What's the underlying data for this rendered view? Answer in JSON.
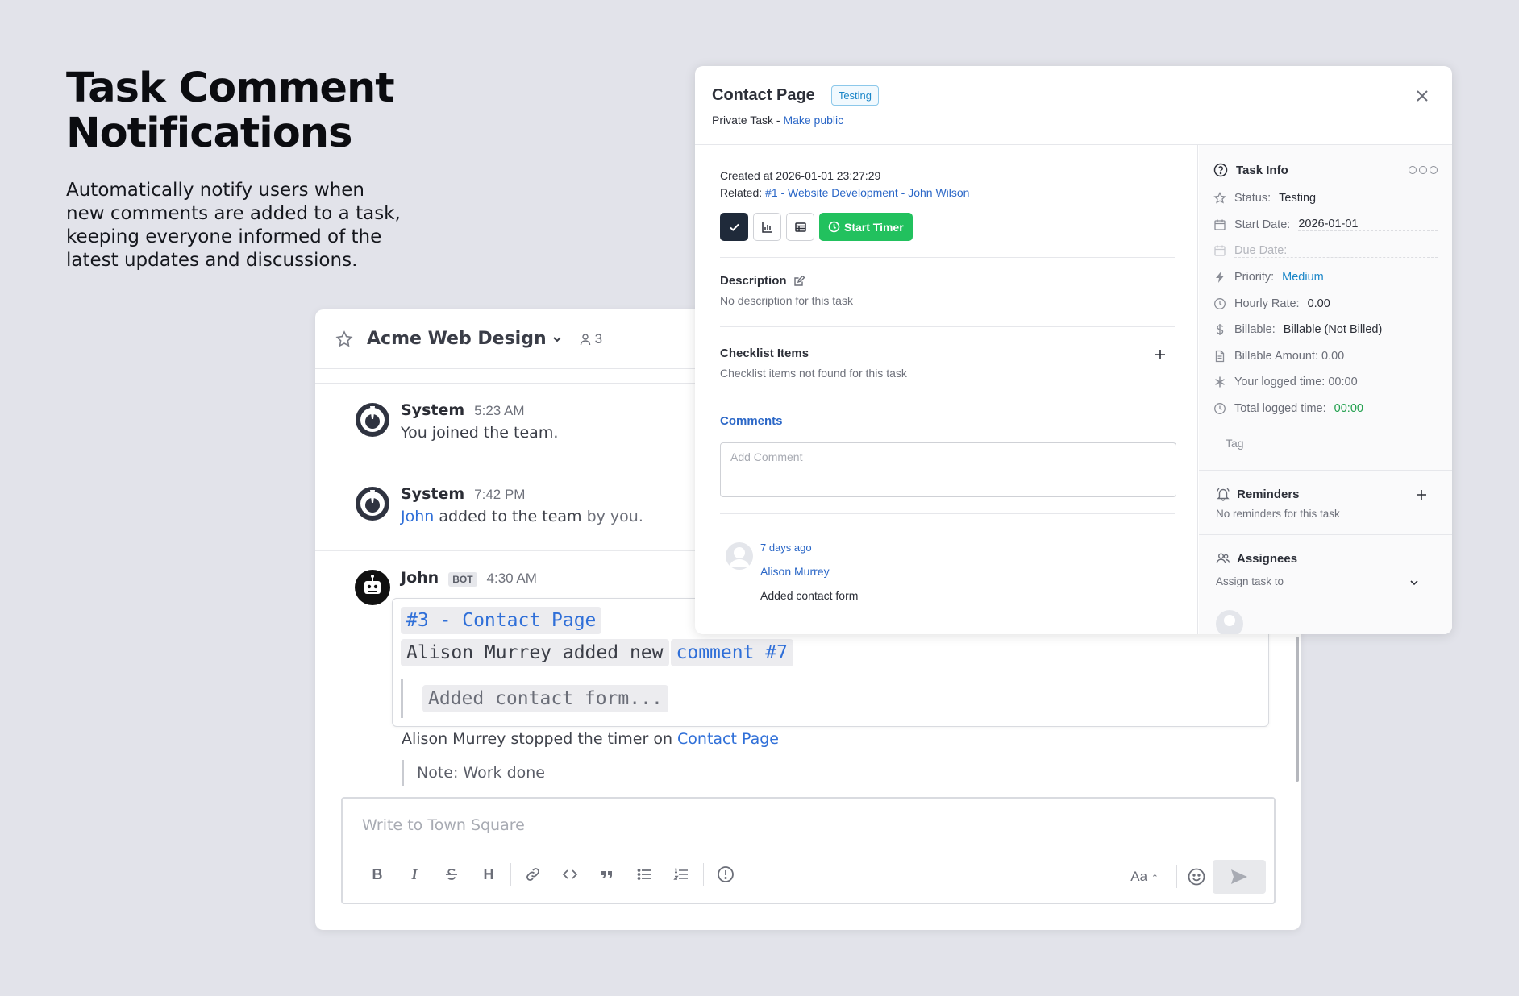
{
  "hero": {
    "title_line1": "Task Comment",
    "title_line2": "Notifications",
    "description": "Automatically notify users when new comments are added to a task, keeping everyone informed of the latest updates and discussions."
  },
  "chat": {
    "team_name": "Acme Web Design",
    "member_count": "3",
    "messages": [
      {
        "name": "System",
        "time": "5:23 AM",
        "text_pre": "You ",
        "text_strong": "joined the team."
      },
      {
        "name": "System",
        "time": "7:42 PM",
        "link": "John",
        "text_strong": " added to the team",
        "text_post": " by you."
      },
      {
        "name": "John",
        "badge": "BOT",
        "time": "4:30 AM"
      }
    ],
    "embed": {
      "task_link": "#3 - Contact Page",
      "line_text": "Alison Murrey added new",
      "comment_link": "comment #7",
      "quote": "Added contact form..."
    },
    "timer_text": "Alison Murrey stopped the timer on ",
    "timer_link": "Contact Page",
    "note": "Note: Work done",
    "composer_placeholder": "Write to Town Square",
    "format_label": "Aa",
    "toolbar": {
      "bold": "B",
      "italic": "I",
      "heading": "H"
    }
  },
  "task": {
    "title": "Contact Page",
    "status_badge": "Testing",
    "privacy": "Private Task - ",
    "make_public": "Make public",
    "created": "Created at 2026-01-01 23:27:29",
    "related_label": "Related: ",
    "related_link": "#1 - Website Development - John Wilson",
    "start_timer": "Start Timer",
    "description_title": "Description",
    "description_empty": "No description for this task",
    "checklist_title": "Checklist Items",
    "checklist_empty": "Checklist items not found for this task",
    "comments_title": "Comments",
    "comment_placeholder": "Add Comment",
    "comment": {
      "ago": "7 days ago",
      "author": "Alison Murrey",
      "body": "Added contact form"
    },
    "info": {
      "title": "Task Info",
      "status_label": "Status:",
      "status": "Testing",
      "start_label": "Start Date:",
      "start": "2026-01-01",
      "due_label": "Due Date:",
      "priority_label": "Priority:",
      "priority": "Medium",
      "rate_label": "Hourly Rate:",
      "rate": "0.00",
      "billable_label": "Billable:",
      "billable": "Billable (Not Billed)",
      "amount_label": "Billable Amount: 0.00",
      "your_time_label": "Your logged time: 00:00",
      "total_label": "Total logged time:",
      "total": "00:00",
      "tag": "Tag"
    },
    "reminders_title": "Reminders",
    "reminders_empty": "No reminders for this task",
    "assignees_title": "Assignees",
    "assign_placeholder": "Assign task to"
  }
}
